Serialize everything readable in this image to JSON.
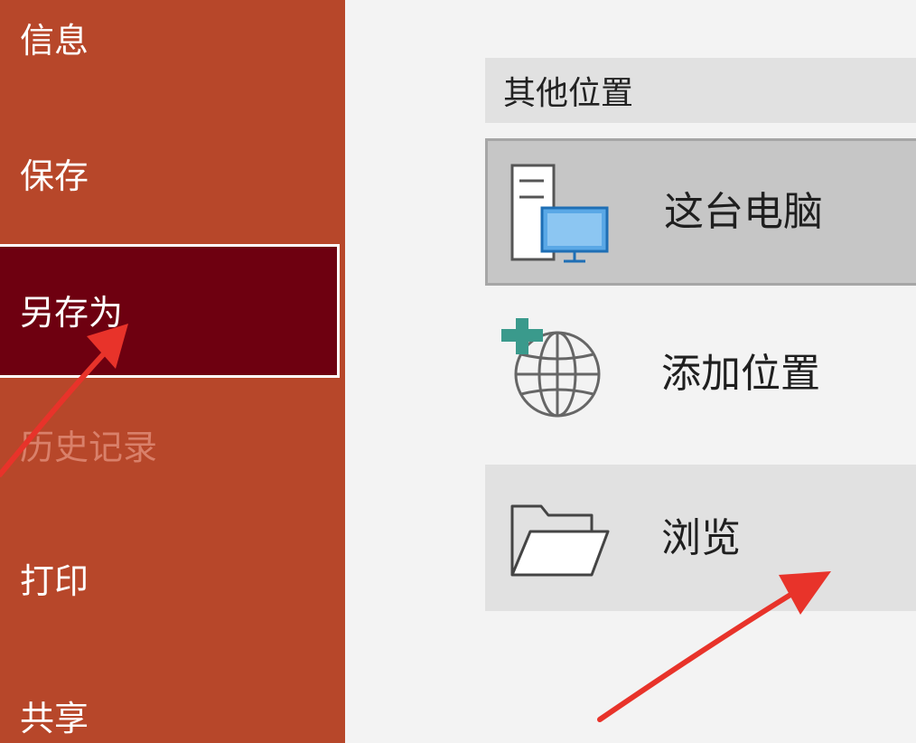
{
  "sidebar": {
    "items": [
      {
        "label": "信息"
      },
      {
        "label": "保存"
      },
      {
        "label": "另存为"
      },
      {
        "label": "历史记录"
      },
      {
        "label": "打印"
      },
      {
        "label": "共享"
      }
    ]
  },
  "locations": {
    "header": "其他位置",
    "items": [
      {
        "label": "这台电脑",
        "icon": "computer-icon"
      },
      {
        "label": "添加位置",
        "icon": "add-location-globe-icon"
      },
      {
        "label": "浏览",
        "icon": "folder-open-icon"
      }
    ]
  },
  "colors": {
    "sidebar_bg": "#b7472a",
    "sidebar_selected_bg": "#6e0010",
    "annotation_arrow": "#e8332a"
  }
}
